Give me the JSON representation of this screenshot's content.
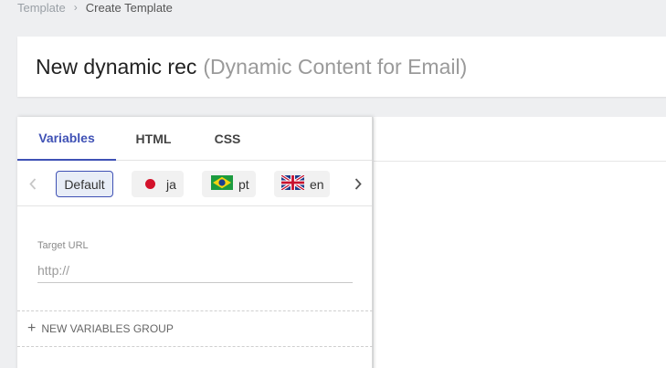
{
  "breadcrumb": {
    "parent": "Template",
    "current": "Create Template"
  },
  "header": {
    "name": "New dynamic rec",
    "type": "(Dynamic Content for Email)"
  },
  "tabs": [
    {
      "label": "Variables",
      "active": true
    },
    {
      "label": "HTML",
      "active": false
    },
    {
      "label": "CSS",
      "active": false
    }
  ],
  "languages": [
    {
      "label": "Default",
      "selected": true
    },
    {
      "label": "ja",
      "flag": "japan-flag-icon"
    },
    {
      "label": "pt",
      "flag": "brazil-flag-icon"
    },
    {
      "label": "en",
      "flag": "uk-flag-icon"
    }
  ],
  "field": {
    "label": "Target URL",
    "placeholder": "http://"
  },
  "new_group_label": "NEW VARIABLES GROUP",
  "colors": {
    "accent": "#3f51b5",
    "background": "#eeeff1"
  }
}
